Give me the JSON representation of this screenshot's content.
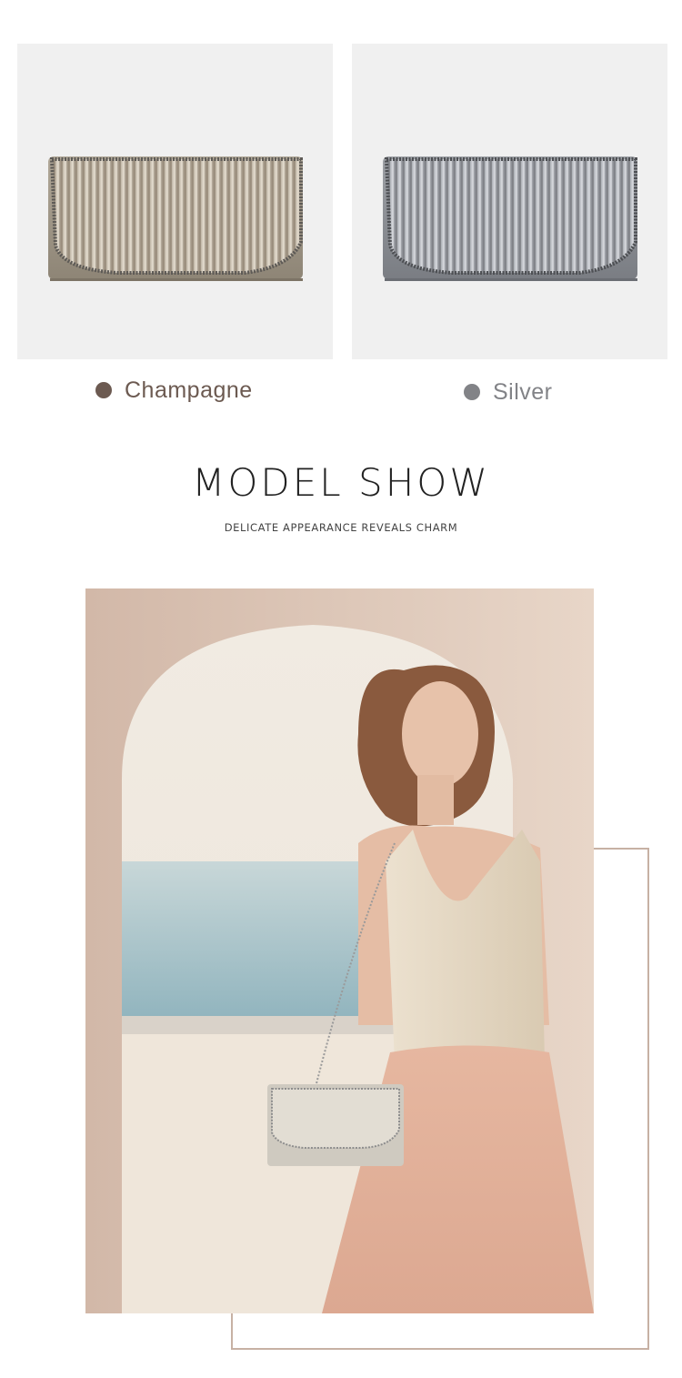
{
  "colors": {
    "champagne": "#6c5a51",
    "silver": "#828387",
    "accent_frame": "#c7b1a4"
  },
  "swatches": [
    {
      "label": "Champagne"
    },
    {
      "label": "Silver"
    }
  ],
  "model_section": {
    "title": "MODEL SHOW",
    "subtitle": "DELICATE APPEARANCE REVEALS CHARM"
  }
}
